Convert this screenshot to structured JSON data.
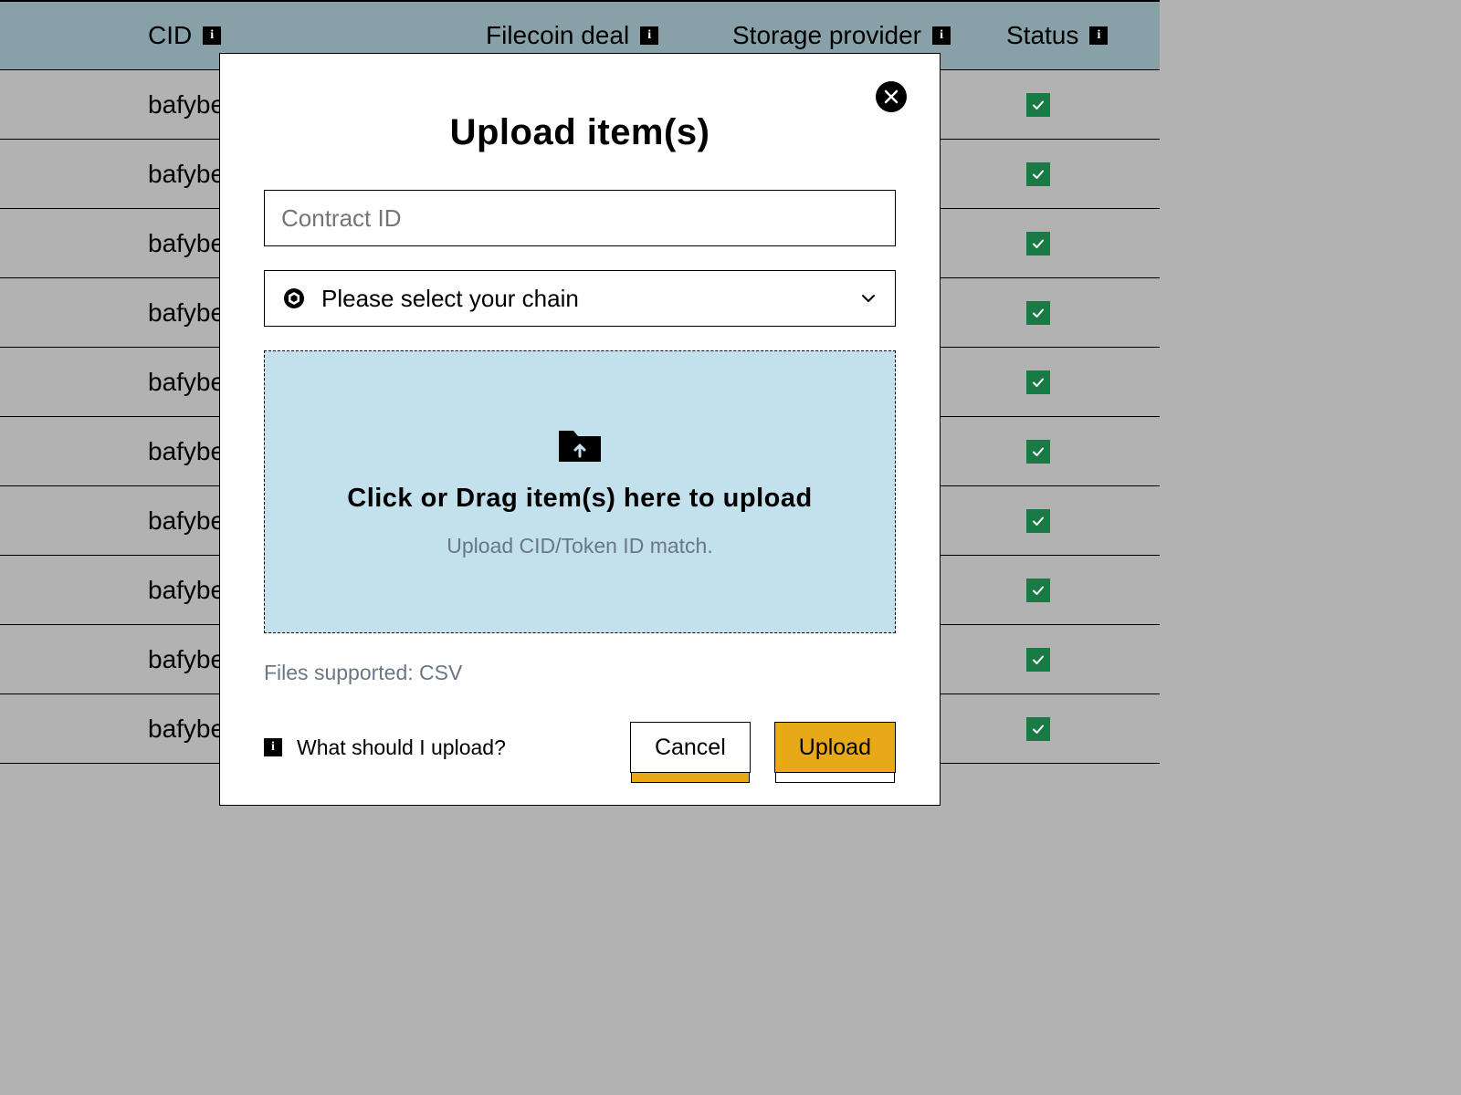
{
  "table": {
    "headers": {
      "cid": "CID",
      "deal": "Filecoin deal",
      "sp": "Storage provider",
      "status": "Status"
    },
    "rows": [
      {
        "cid": "bafybei",
        "status": "ok"
      },
      {
        "cid": "bafybei",
        "status": "ok"
      },
      {
        "cid": "bafybei",
        "status": "ok"
      },
      {
        "cid": "bafybei",
        "status": "ok"
      },
      {
        "cid": "bafybei",
        "status": "ok"
      },
      {
        "cid": "bafybei",
        "status": "ok"
      },
      {
        "cid": "bafybei",
        "status": "ok"
      },
      {
        "cid": "bafybei",
        "status": "ok"
      },
      {
        "cid": "bafybei",
        "status": "ok"
      },
      {
        "cid": "bafybei",
        "status": "ok"
      }
    ]
  },
  "modal": {
    "title": "Upload item(s)",
    "contract_placeholder": "Contract ID",
    "chain_select_label": "Please select your chain",
    "dropzone_title": "Click or Drag item(s) here to upload",
    "dropzone_sub": "Upload CID/Token ID match.",
    "files_supported": "Files supported: CSV",
    "help_text": "What should I upload?",
    "cancel_label": "Cancel",
    "upload_label": "Upload"
  }
}
